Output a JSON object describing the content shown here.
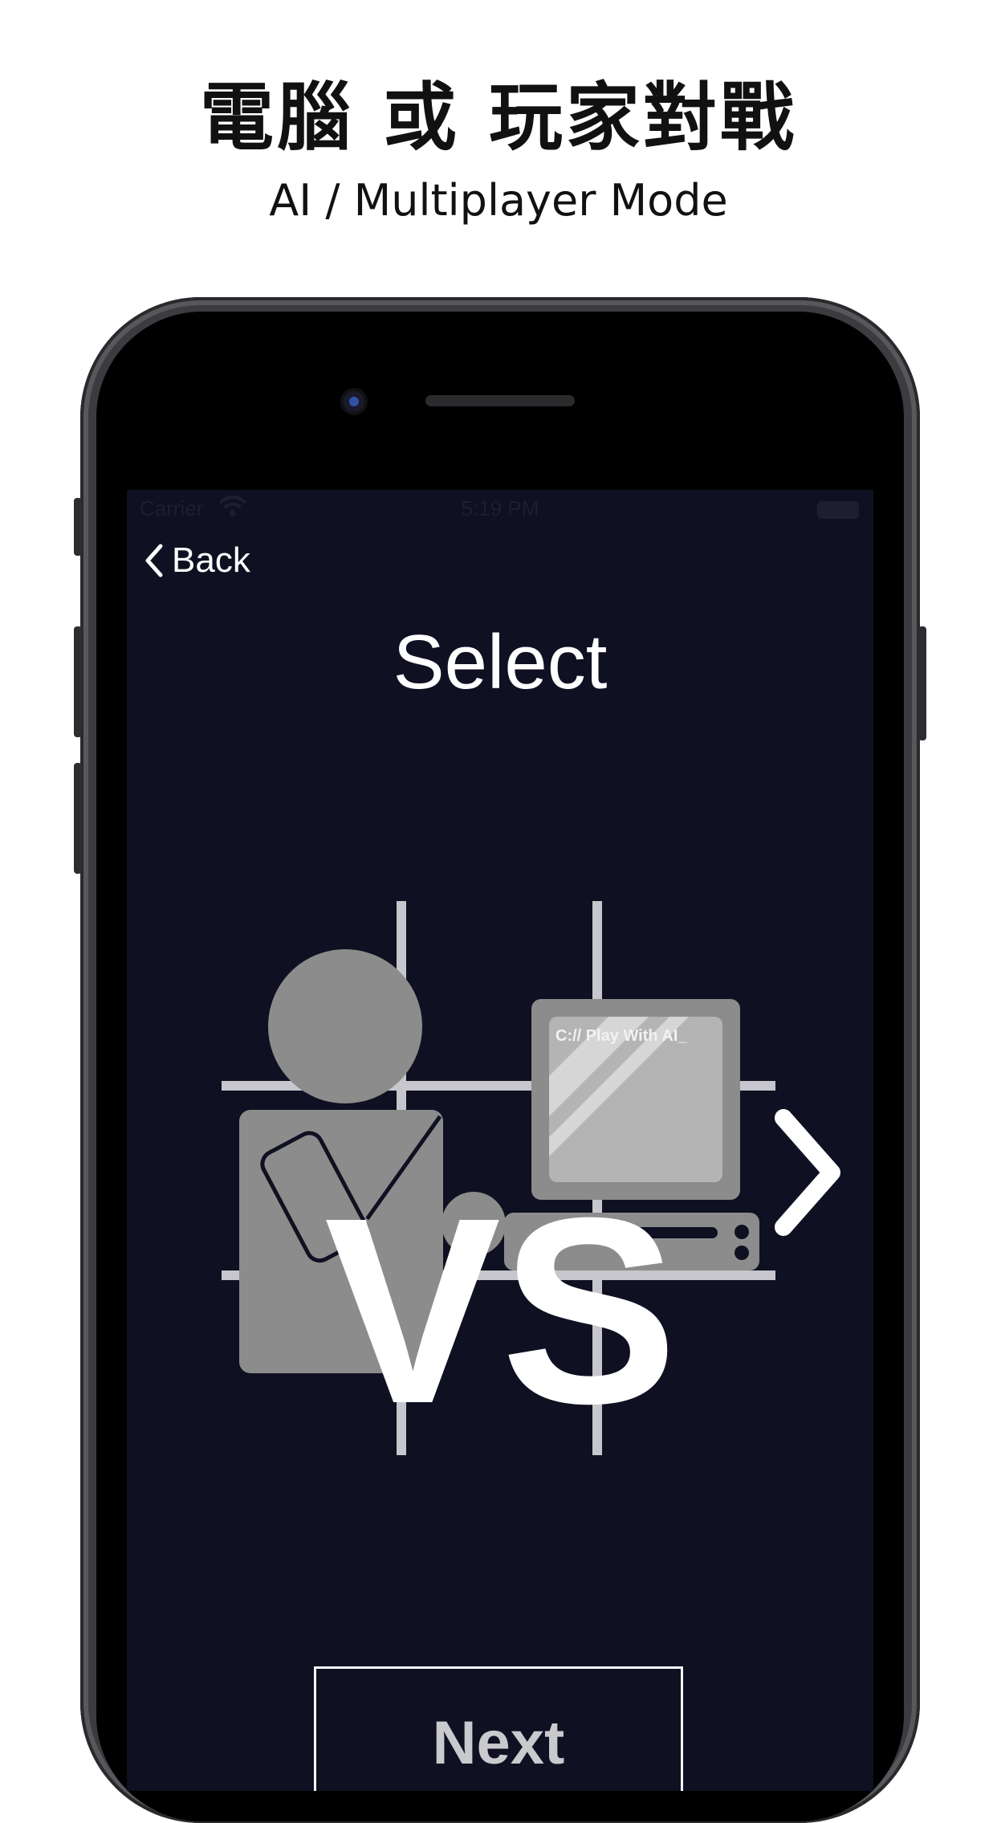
{
  "promo": {
    "headline": "電腦 或 玩家對戰",
    "subheadline": "AI / Multiplayer Mode"
  },
  "status_bar": {
    "carrier": "Carrier",
    "time": "5:19 PM"
  },
  "nav": {
    "back_label": "Back"
  },
  "screen": {
    "title": "Select",
    "monitor_text": "C:// Play With AI_",
    "vs_label": "VS",
    "next_label": "Next"
  },
  "colors": {
    "screen_background": "#0f1021",
    "grid_lines": "#c6c6cc",
    "figure_gray": "#8c8c8c",
    "monitor_glass": "#b4b4b4",
    "text_white": "#ffffff"
  },
  "icons": {
    "back": "chevron-left-icon",
    "next_option": "chevron-right-icon",
    "wifi": "wifi-icon",
    "battery": "battery-icon"
  }
}
